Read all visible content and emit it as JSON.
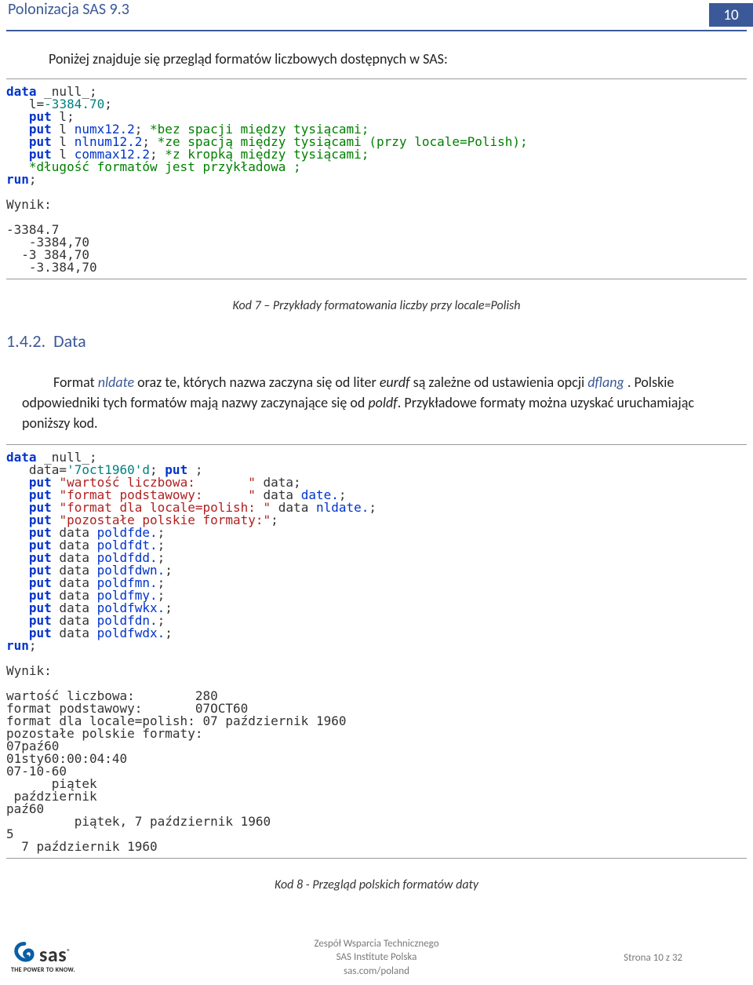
{
  "header": {
    "title": "Polonizacja SAS 9.3",
    "page_number": "10"
  },
  "intro": "Poniżej znajduje się przegląd formatów liczbowych dostępnych w SAS:",
  "code1": {
    "line1_kw": "data",
    "line1_sp": " _null_;",
    "line2": "   l=",
    "line2_val": "-3384.70",
    "line2_end": ";",
    "line3_kw": "   put",
    "line3_end": " l;",
    "line4_kw": "   put",
    "line4_mid": " l ",
    "line4_fmt": "numx12.2",
    "line4_semi": ";",
    "line4_comment": " *bez spacji między tysiącami;",
    "line5_kw": "   put",
    "line5_mid": " l ",
    "line5_fmt": "nlnum12.2",
    "line5_semi": ";",
    "line5_comment": " *ze spacją między tysiącami (przy locale=Polish);",
    "line6_kw": "   put",
    "line6_mid": " l ",
    "line6_fmt": "commax12.2",
    "line6_semi": ";",
    "line6_comment": " *z kropką między tysiącami;",
    "line7_comment": "   *długość formatów jest przykładowa ;",
    "line8_kw": "run",
    "line8_end": ";",
    "wynik_label": "Wynik:",
    "out1": "-3384.7",
    "out2": "   -3384,70",
    "out3": "  -3 384,70",
    "out4": "   -3.384,70"
  },
  "caption1": "Kod 7 – Przykłady formatowania liczby przy locale=Polish",
  "section": {
    "num": "1.4.2.",
    "title": "Data"
  },
  "paragraph": {
    "t1": "Format ",
    "nldate": "nldate",
    "t2": " oraz te, których nazwa zaczyna się od liter ",
    "eurdf": "eurdf",
    "t3": " są zależne od ustawienia opcji ",
    "dflang": "dflang",
    "t4": " . Polskie odpowiedniki tych formatów mają nazwy zaczynające się od ",
    "poldf": "poldf",
    "t5": ". Przykładowe formaty można uzyskać uruchamiając poniższy kod."
  },
  "code2": {
    "l1_kw": "data",
    "l1_sp": " _null_;",
    "l2a": "   data=",
    "l2b": "'7oct1960'd",
    "l2c": "; ",
    "l2d": "put",
    "l2e": " ;",
    "l3a": "   put",
    "l3b": " ",
    "l3c": "\"wartość liczbowa:       \"",
    "l3d": " data;",
    "l4a": "   put",
    "l4b": " ",
    "l4c": "\"format podstawowy:      \"",
    "l4d": " data ",
    "l4e": "date.",
    "l4f": ";",
    "l5a": "   put",
    "l5b": " ",
    "l5c": "\"format dla locale=polish: \"",
    "l5d": " data ",
    "l5e": "nldate.",
    "l5f": ";",
    "l6a": "   put",
    "l6b": " ",
    "l6c": "\"pozostałe polskie formaty:\"",
    "l6d": ";",
    "l7a": "   put",
    "l7b": " data ",
    "l7c": "poldfde.",
    "l7d": ";",
    "l8a": "   put",
    "l8b": " data ",
    "l8c": "poldfdt.",
    "l8d": ";",
    "l9a": "   put",
    "l9b": " data ",
    "l9c": "poldfdd.",
    "l9d": ";",
    "l10a": "   put",
    "l10b": " data ",
    "l10c": "poldfdwn.",
    "l10d": ";",
    "l11a": "   put",
    "l11b": " data ",
    "l11c": "poldfmn.",
    "l11d": ";",
    "l12a": "   put",
    "l12b": " data ",
    "l12c": "poldfmy.",
    "l12d": ";",
    "l13a": "   put",
    "l13b": " data ",
    "l13c": "poldfwkx.",
    "l13d": ";",
    "l14a": "   put",
    "l14b": " data ",
    "l14c": "poldfdn.",
    "l14d": ";",
    "l15a": "   put",
    "l15b": " data ",
    "l15c": "poldfwdx.",
    "l15d": ";",
    "l16a": "run",
    "l16b": ";",
    "wynik_label": "Wynik:",
    "o1": "wartość liczbowa:        280",
    "o2": "format podstawowy:       07OCT60",
    "o3": "format dla locale=polish: 07 październik 1960",
    "o4": "pozostałe polskie formaty:",
    "o5": "07paź60",
    "o6": "01sty60:00:04:40",
    "o7": "07-10-60",
    "o8": "      piątek",
    "o9": " październik",
    "o10": "paź60",
    "o11": "         piątek, 7 październik 1960",
    "o12": "5",
    "o13": "  7 październik 1960"
  },
  "caption2": "Kod 8 - Przegląd polskich formatów daty",
  "footer": {
    "team": "Zespół Wsparcia Technicznego",
    "company": "SAS Institute Polska",
    "url": "sas.com/poland",
    "page": "Strona 10 z 32",
    "logo_text": "sas",
    "tagline": "THE POWER TO KNOW."
  }
}
